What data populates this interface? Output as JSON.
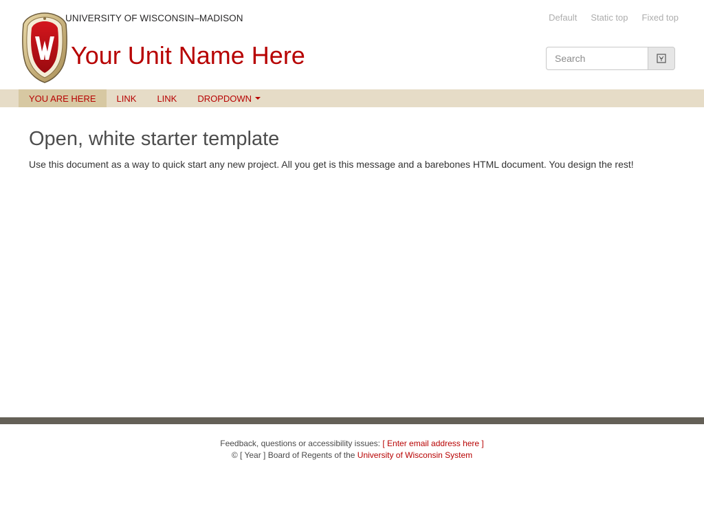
{
  "header": {
    "university": "UNIVERSITY OF WISCONSIN–MADISON",
    "unit_name": "Your Unit Name Here",
    "top_links": [
      "Default",
      "Static top",
      "Fixed top"
    ],
    "search_placeholder": "Search"
  },
  "nav": {
    "items": [
      "YOU ARE HERE",
      "LINK",
      "LINK",
      "DROPDOWN"
    ]
  },
  "main": {
    "title": "Open, white starter template",
    "text": "Use this document as a way to quick start any new project. All you get is this message and a barebones HTML document. You design the rest!"
  },
  "footer": {
    "feedback_label": "Feedback, questions or accessibility issues:",
    "email_link": "[ Enter email address here ]",
    "copyright_prefix": "© [ Year ] Board of Regents of the",
    "system_link": "University of Wisconsin System"
  },
  "colors": {
    "brand_red": "#b70101",
    "nav_bg": "#e6dcc7",
    "nav_active": "#d7c8a2",
    "footer_bar": "#646057"
  },
  "icons": {
    "crest": "uw-crest-icon",
    "search": "search-icon",
    "dropdown": "caret-down-icon"
  }
}
